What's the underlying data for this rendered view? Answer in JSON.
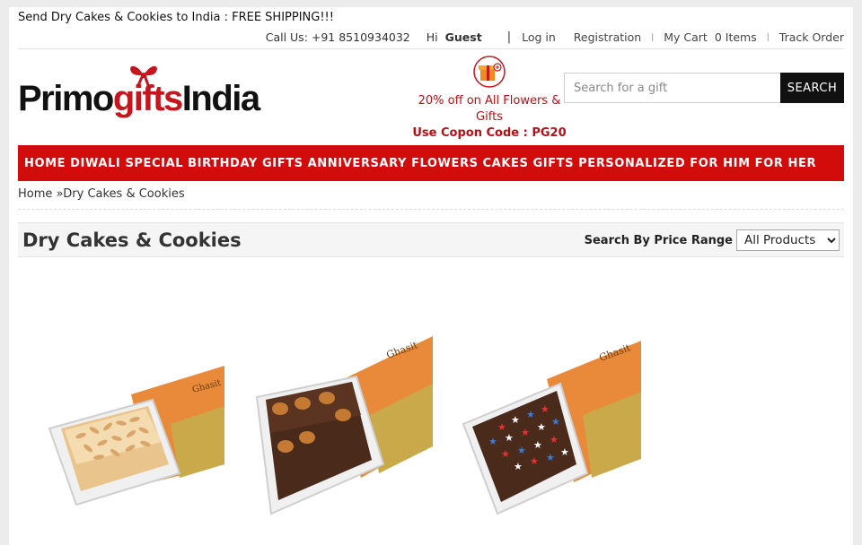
{
  "promo": "Send Dry Cakes & Cookies to India : FREE SHIPPING!!!",
  "top_links": {
    "call": "Call Us: +91 8510934032",
    "hi": "Hi",
    "guest": "Guest",
    "separator": "|",
    "login": "Log in",
    "registration": "Registration",
    "my_cart": "My Cart",
    "cart_count": "0 Items",
    "track_order": "Track Order"
  },
  "logo": {
    "part1": "Primo",
    "part2": "gifts",
    "part3": "India"
  },
  "offer": {
    "line1": "20% off on All Flowers &",
    "line2": "Gifts",
    "coupon": "Use Copon Code : PG20"
  },
  "search": {
    "placeholder": "Search for a gift",
    "value": "",
    "button": "SEARCH"
  },
  "nav": [
    "HOME",
    "DIWALI SPECIAL",
    "BIRTHDAY GIFTS",
    "ANNIVERSARY",
    "FLOWERS",
    "CAKES",
    "GIFTS",
    "PERSONALIZED",
    "FOR HIM",
    "FOR HER"
  ],
  "breadcrumb": {
    "home": "Home",
    "separator": "»",
    "current": "Dry Cakes & Cookies"
  },
  "category": {
    "title": "Dry Cakes & Cookies",
    "price_label": "Search By Price Range",
    "price_selected": "All Products"
  },
  "products": [
    {
      "icon": "almond-dry-cake-image",
      "box_text": "Ghasit"
    },
    {
      "icon": "walnut-chocolate-dry-cake-image",
      "box_text": "Ghasit"
    },
    {
      "icon": "star-sprinkle-chocolate-dry-cake-image",
      "box_text": "Ghasit"
    }
  ],
  "colors": {
    "brand_red": "#d20b0b",
    "offer_red": "#b51016",
    "search_button": "#111111"
  }
}
